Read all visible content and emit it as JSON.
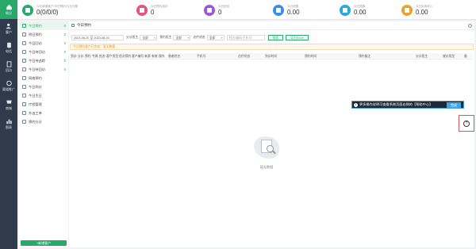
{
  "nav": {
    "items": [
      {
        "label": "概况",
        "icon": "home-icon",
        "active": true
      },
      {
        "label": "客户",
        "icon": "customers-icon",
        "active": false
      },
      {
        "label": "电话",
        "icon": "phone-icon",
        "active": false
      },
      {
        "label": "回访",
        "icon": "callback-icon",
        "active": false
      },
      {
        "label": "渠道推广",
        "icon": "channel-icon",
        "active": false
      },
      {
        "label": "商城",
        "icon": "shop-icon",
        "active": false
      },
      {
        "label": "图表",
        "icon": "chart-icon",
        "active": false
      }
    ]
  },
  "stats": [
    {
      "label": "今日新增客户/今日预约/今日分配",
      "value": "0(0/0/0)",
      "color": "#28a86b",
      "icon": "user-icon"
    },
    {
      "label": "今日预约到诊",
      "value": "0",
      "color": "#e0567c",
      "icon": "calendar-icon"
    },
    {
      "label": "今日回访",
      "value": "0",
      "color": "#9b59d6",
      "icon": "chat-icon"
    },
    {
      "label": "今日消费",
      "value": "0.00",
      "color": "#3a8ee6",
      "icon": "house-icon"
    },
    {
      "label": "今日退款",
      "value": "0.00",
      "color": "#2aa9d8",
      "icon": "refund-icon"
    },
    {
      "label": "今日实收收入",
      "value": "0.00",
      "color": "#e9a22c",
      "icon": "money-icon"
    }
  ],
  "subnav": {
    "items": [
      {
        "label": "今日预约",
        "count": "0",
        "active": true
      },
      {
        "label": "明日预约",
        "count": "0",
        "active": false
      },
      {
        "label": "今日回访",
        "count": "0",
        "active": false
      },
      {
        "label": "今日待回访",
        "count": "0",
        "active": false
      },
      {
        "label": "今日待追踪",
        "count": "0",
        "active": false
      },
      {
        "label": "今日待回访",
        "count": "0",
        "active": false
      },
      {
        "label": "网络预约",
        "count": "",
        "active": false
      },
      {
        "label": "今日到诊",
        "count": "",
        "active": false
      },
      {
        "label": "今日生日",
        "count": "",
        "active": false
      },
      {
        "label": "疗程管理",
        "count": "",
        "active": false
      },
      {
        "label": "外出工单",
        "count": "",
        "active": false
      },
      {
        "label": "预约分诊",
        "count": "",
        "active": false
      }
    ],
    "add_button": "+新增客户"
  },
  "main": {
    "title": "今日预约",
    "date_range": "2023-08-20 至 2023-08-20",
    "filters": [
      {
        "label": "分诊医生",
        "value": "全部"
      },
      {
        "label": "预约医生",
        "value": "全部"
      },
      {
        "label": "治疗状态",
        "value": "全部"
      }
    ],
    "search_placeholder": "姓名/编码/手机号",
    "search_button": "搜索",
    "export_button": "导出Excel",
    "notice": "今日预约客户已完成：暂无数据",
    "columns": [
      "到诊",
      "分诊",
      "预约",
      "专属",
      "姓名",
      "客户类型",
      "首次预约",
      "客户编号",
      "来源",
      "有效",
      "操作",
      "患者姓名",
      "手机号",
      "治疗状态",
      "到诊时间",
      "预约时间",
      "预约备注",
      "分诊医生",
      "就诊类型",
      "备"
    ],
    "empty_text": "暂无数据"
  },
  "guide": {
    "text": "更多操作说明可查看系统页面右侧的【帮助中心】",
    "done_button": "完成",
    "help_symbol": "?"
  }
}
